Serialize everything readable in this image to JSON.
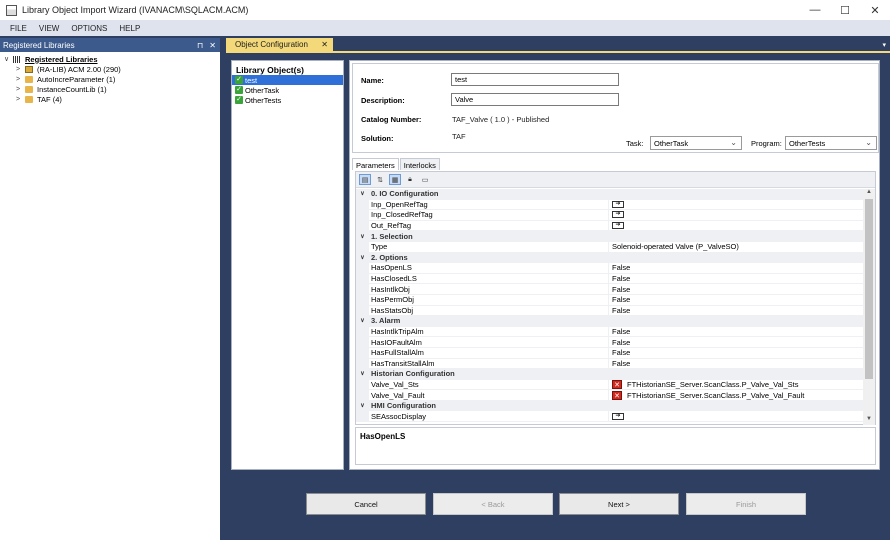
{
  "window": {
    "title": "Library Object Import Wizard  (IVANACM\\SQLACM.ACM)",
    "controls": [
      "—",
      "☐",
      "✕"
    ]
  },
  "menu": [
    "FILE",
    "VIEW",
    "OPTIONS",
    "HELP"
  ],
  "dock": {
    "title": "Registered Libraries",
    "pin": "⊓",
    "close": "✕",
    "tree": [
      {
        "label": "Registered Libraries",
        "level": 0,
        "expander": "∨",
        "icon": "library-root-icon"
      },
      {
        "label": "(RA-LIB) ACM 2.00  (290)",
        "level": 1,
        "expander": ">",
        "icon": "library-icon"
      },
      {
        "label": "AutoIncreParameter  (1)",
        "level": 1,
        "expander": ">",
        "icon": "folder-icon"
      },
      {
        "label": "InstanceCountLib  (1)",
        "level": 1,
        "expander": ">",
        "icon": "folder-icon"
      },
      {
        "label": "TAF  (4)",
        "level": 1,
        "expander": ">",
        "icon": "folder-icon"
      }
    ]
  },
  "doc_tab": {
    "label": "Object Configuration",
    "close": "✕",
    "overflow": "▾"
  },
  "objects": {
    "header": "Library Object(s)",
    "items": [
      {
        "label": "test",
        "selected": true
      },
      {
        "label": "OtherTask",
        "selected": false
      },
      {
        "label": "OtherTests",
        "selected": false
      }
    ]
  },
  "props": {
    "name_label": "Name:",
    "name_value": "test",
    "desc_label": "Description:",
    "desc_value": "Valve",
    "catalog_label": "Catalog Number:",
    "catalog_value": "TAF_Valve    ( 1.0 )  -  Published",
    "solution_label": "Solution:",
    "solution_value": "TAF",
    "task_label": "Task:",
    "task_value": "OtherTask",
    "program_label": "Program:",
    "program_value": "OtherTests"
  },
  "tabs": [
    {
      "label": "Parameters",
      "active": true
    },
    {
      "label": "Interlocks",
      "active": false
    }
  ],
  "grid_toolbar": [
    "categorized-icon",
    "alphabetical-icon",
    "properties-icon",
    "lock-icon",
    "property-pages-icon"
  ],
  "grid_rows": [
    {
      "type": "cat",
      "name": "0. IO Configuration"
    },
    {
      "type": "prop",
      "name": "Inp_OpenRefTag",
      "value": "",
      "kind": "link"
    },
    {
      "type": "prop",
      "name": "Inp_ClosedRefTag",
      "value": "",
      "kind": "link"
    },
    {
      "type": "prop",
      "name": "Out_RefTag",
      "value": "",
      "kind": "link"
    },
    {
      "type": "cat",
      "name": "1. Selection"
    },
    {
      "type": "prop",
      "name": "Type",
      "value": "Solenoid-operated Valve (P_ValveSO)",
      "kind": "text"
    },
    {
      "type": "cat",
      "name": "2. Options"
    },
    {
      "type": "prop",
      "name": "HasOpenLS",
      "value": "False",
      "kind": "text"
    },
    {
      "type": "prop",
      "name": "HasClosedLS",
      "value": "False",
      "kind": "text"
    },
    {
      "type": "prop",
      "name": "HasIntlkObj",
      "value": "False",
      "kind": "text"
    },
    {
      "type": "prop",
      "name": "HasPermObj",
      "value": "False",
      "kind": "text"
    },
    {
      "type": "prop",
      "name": "HasStatsObj",
      "value": "False",
      "kind": "text"
    },
    {
      "type": "cat",
      "name": "3. Alarm"
    },
    {
      "type": "prop",
      "name": "HasIntlkTripAlm",
      "value": "False",
      "kind": "text"
    },
    {
      "type": "prop",
      "name": "HasIOFaultAlm",
      "value": "False",
      "kind": "text"
    },
    {
      "type": "prop",
      "name": "HasFullStallAlm",
      "value": "False",
      "kind": "text"
    },
    {
      "type": "prop",
      "name": "HasTransitStallAlm",
      "value": "False",
      "kind": "text"
    },
    {
      "type": "cat",
      "name": "Historian Configuration"
    },
    {
      "type": "prop",
      "name": "Valve_Val_Sts",
      "value": "FTHistorianSE_Server.ScanClass.P_Valve_Val_Sts",
      "kind": "error"
    },
    {
      "type": "prop",
      "name": "Valve_Val_Fault",
      "value": "FTHistorianSE_Server.ScanClass.P_Valve_Val_Fault",
      "kind": "error"
    },
    {
      "type": "cat",
      "name": "HMI Configuration"
    },
    {
      "type": "prop",
      "name": "SEAssocDisplay",
      "value": "",
      "kind": "link"
    }
  ],
  "description_panel": {
    "title": "HasOpenLS"
  },
  "buttons": {
    "cancel": "Cancel",
    "back": "< Back",
    "next": "Next >",
    "finish": "Finish"
  }
}
